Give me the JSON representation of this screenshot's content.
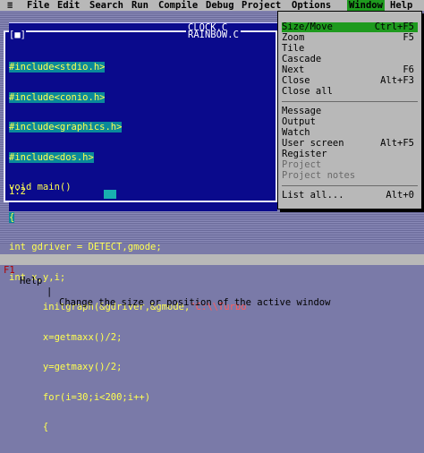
{
  "menubar": {
    "sys": "≡",
    "items": [
      "File",
      "Edit",
      "Search",
      "Run",
      "Compile",
      "Debug",
      "Project",
      "Options",
      "Window",
      "Help"
    ]
  },
  "windows": {
    "back_title": "CLOCK.C",
    "front_title": "RAINBOW.C",
    "front_close": "[■]",
    "status": "1:2"
  },
  "code": [
    {
      "text": "#include<stdio.h>",
      "kind": "inc"
    },
    {
      "text": "#include<conio.h>",
      "kind": "inc"
    },
    {
      "text": "#include<graphics.h>",
      "kind": "inc"
    },
    {
      "text": "#include<dos.h>",
      "kind": "inc"
    },
    {
      "text": "void main()",
      "kind": "plain"
    },
    {
      "text": "{",
      "kind": "inc"
    },
    {
      "text": "int gdriver = DETECT,gmode;",
      "kind": "plain"
    },
    {
      "text": "int x,y,i;",
      "kind": "plain"
    },
    {
      "text": "      initgraph(&gdriver,&gmode,",
      "kind": "plain",
      "str": "\"C:\\\\Turbo"
    },
    {
      "text": "      x=getmaxx()/2;",
      "kind": "plain"
    },
    {
      "text": "      y=getmaxy()/2;",
      "kind": "plain"
    },
    {
      "text": "      for(i=30;i<200;i++)",
      "kind": "plain"
    },
    {
      "text": "      {",
      "kind": "plain"
    }
  ],
  "window_menu": {
    "items": [
      {
        "label": "Size/Move",
        "shortcut": "Ctrl+F5",
        "selected": true,
        "disabled": false
      },
      {
        "label": "Zoom",
        "shortcut": "F5",
        "selected": false,
        "disabled": false
      },
      {
        "label": "Tile",
        "shortcut": "",
        "selected": false,
        "disabled": false
      },
      {
        "label": "Cascade",
        "shortcut": "",
        "selected": false,
        "disabled": false
      },
      {
        "label": "Next",
        "shortcut": "F6",
        "selected": false,
        "disabled": false
      },
      {
        "label": "Close",
        "shortcut": "Alt+F3",
        "selected": false,
        "disabled": false
      },
      {
        "label": "Close all",
        "shortcut": "",
        "selected": false,
        "disabled": false
      },
      {
        "label": "Message",
        "shortcut": "",
        "selected": false,
        "disabled": false
      },
      {
        "label": "Output",
        "shortcut": "",
        "selected": false,
        "disabled": false
      },
      {
        "label": "Watch",
        "shortcut": "",
        "selected": false,
        "disabled": false
      },
      {
        "label": "User screen",
        "shortcut": "Alt+F5",
        "selected": false,
        "disabled": false
      },
      {
        "label": "Register",
        "shortcut": "",
        "selected": false,
        "disabled": false
      },
      {
        "label": "Project",
        "shortcut": "",
        "selected": false,
        "disabled": true
      },
      {
        "label": "Project notes",
        "shortcut": "",
        "selected": false,
        "disabled": true
      },
      {
        "label": "List all...",
        "shortcut": "Alt+0",
        "selected": false,
        "disabled": false
      }
    ]
  },
  "statusbar": {
    "key": "F1",
    "key_label": "Help",
    "sep": "|",
    "message": "Change the size or position of the active window"
  },
  "colors": {
    "editor_bg": "#0a0a8c",
    "menu_bg": "#b8b8b8",
    "highlight": "#1e9a1e",
    "code_text": "#ffff50",
    "include_bg": "#0a8a9a"
  }
}
